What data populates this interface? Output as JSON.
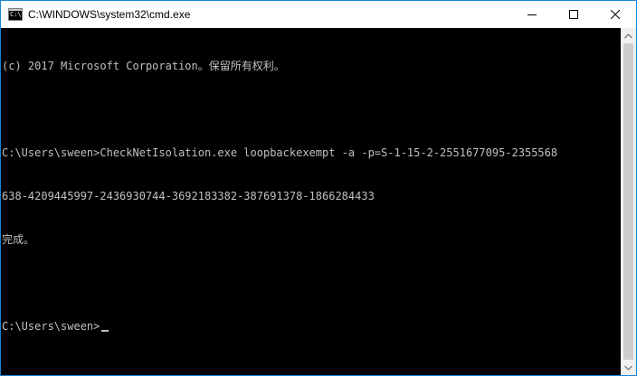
{
  "window": {
    "title": "C:\\WINDOWS\\system32\\cmd.exe",
    "icon": "cmd-icon",
    "icon_text": "C:\\"
  },
  "titlebar_buttons": {
    "minimize": "minimize-icon",
    "maximize": "maximize-icon",
    "close": "close-icon"
  },
  "console": {
    "lines": [
      "(c) 2017 Microsoft Corporation。保留所有权利。",
      "",
      "C:\\Users\\sween>CheckNetIsolation.exe loopbackexempt -a -p=S-1-15-2-2551677095-2355568",
      "638-4209445997-2436930744-3692183382-387691378-1866284433",
      "完成。",
      "",
      "C:\\Users\\sween>"
    ]
  },
  "colors": {
    "console_bg": "#000000",
    "console_fg": "#c0c0c0",
    "window_border": "#1883d7"
  }
}
